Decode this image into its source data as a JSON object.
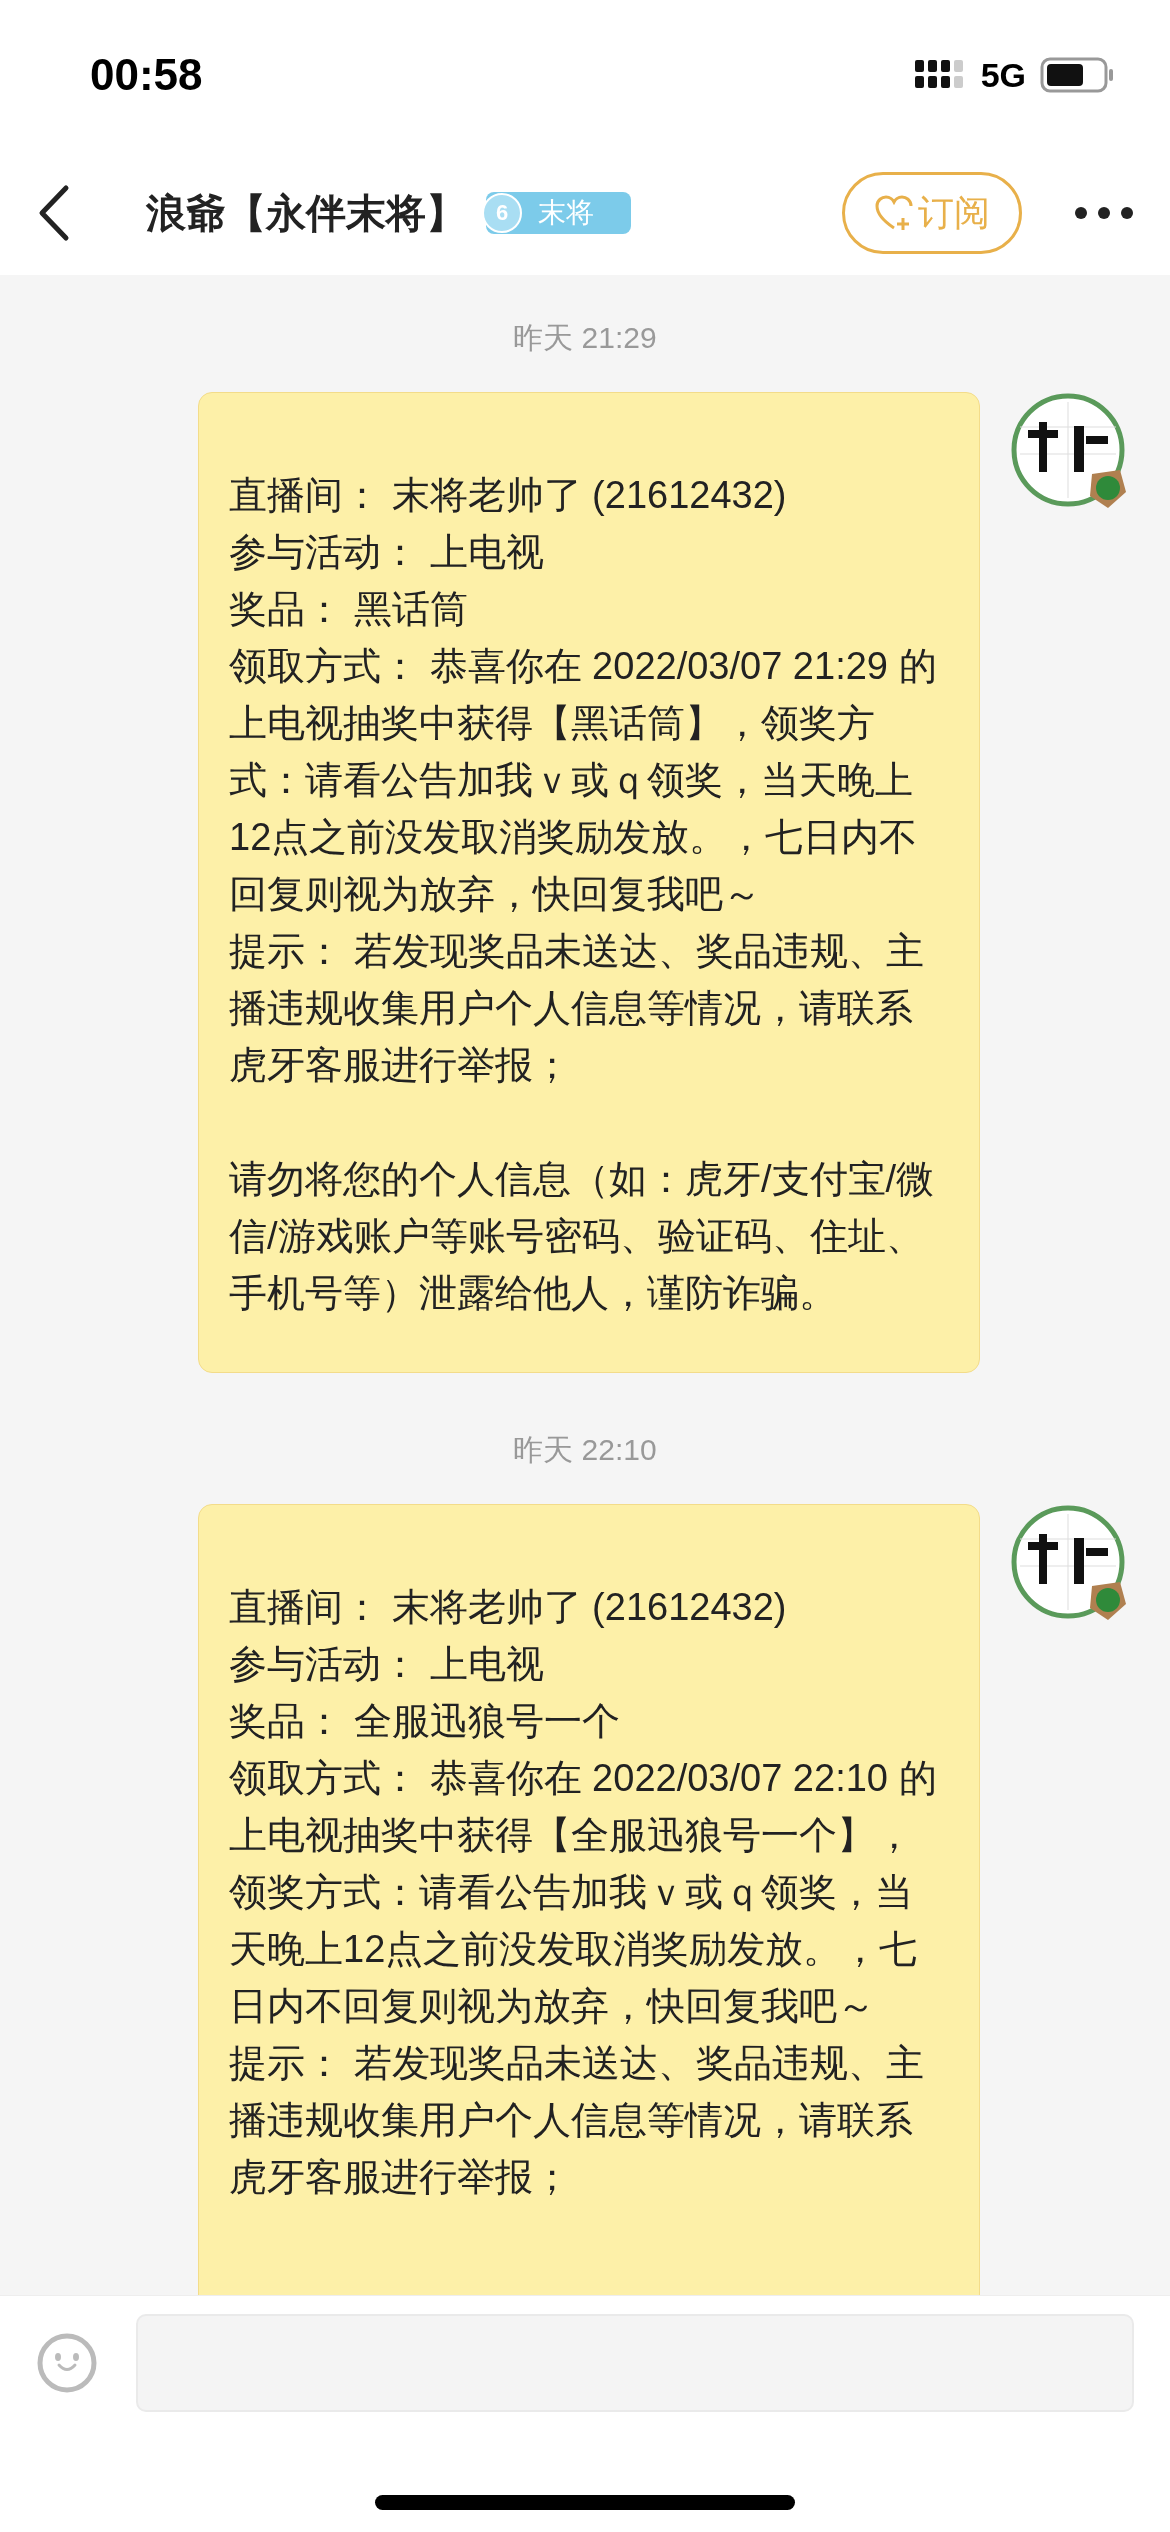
{
  "status_bar": {
    "time": "00:58",
    "network": "5G"
  },
  "header": {
    "title": "浪爺【永伴末将】",
    "badge": {
      "level": "6",
      "name": "末将"
    },
    "subscribe": "订阅"
  },
  "messages": [
    {
      "time": "昨天 21:29",
      "paragraphs": [
        "直播间： 末将老帅了 (21612432)",
        "参与活动： 上电视",
        "奖品： 黑话筒",
        "领取方式： 恭喜你在 2022/03/07 21:29 的上电视抽奖中获得【黑话筒】，领奖方式：请看公告加我ｖ或ｑ领奖，当天晚上12点之前没发取消奖励发放。，七日内不回复则视为放弃，快回复我吧～",
        "提示： 若发现奖品未送达、奖品违规、主播违规收集用户个人信息等情况，请联系虎牙客服进行举报；",
        "请勿将您的个人信息（如：虎牙/支付宝/微信/游戏账户等账号密码、验证码、住址、手机号等）泄露给他人，谨防诈骗。"
      ]
    },
    {
      "time": "昨天 22:10",
      "paragraphs": [
        "直播间： 末将老帅了 (21612432)",
        "参与活动： 上电视",
        "奖品： 全服迅狼号一个",
        "领取方式： 恭喜你在 2022/03/07 22:10 的上电视抽奖中获得【全服迅狼号一个】，领奖方式：请看公告加我ｖ或ｑ领奖，当天晚上12点之前没发取消奖励发放。，七日内不回复则视为放弃，快回复我吧～",
        "提示： 若发现奖品未送达、奖品违规、主播违规收集用户个人信息等情况，请联系虎牙客服进行举报；"
      ]
    }
  ]
}
